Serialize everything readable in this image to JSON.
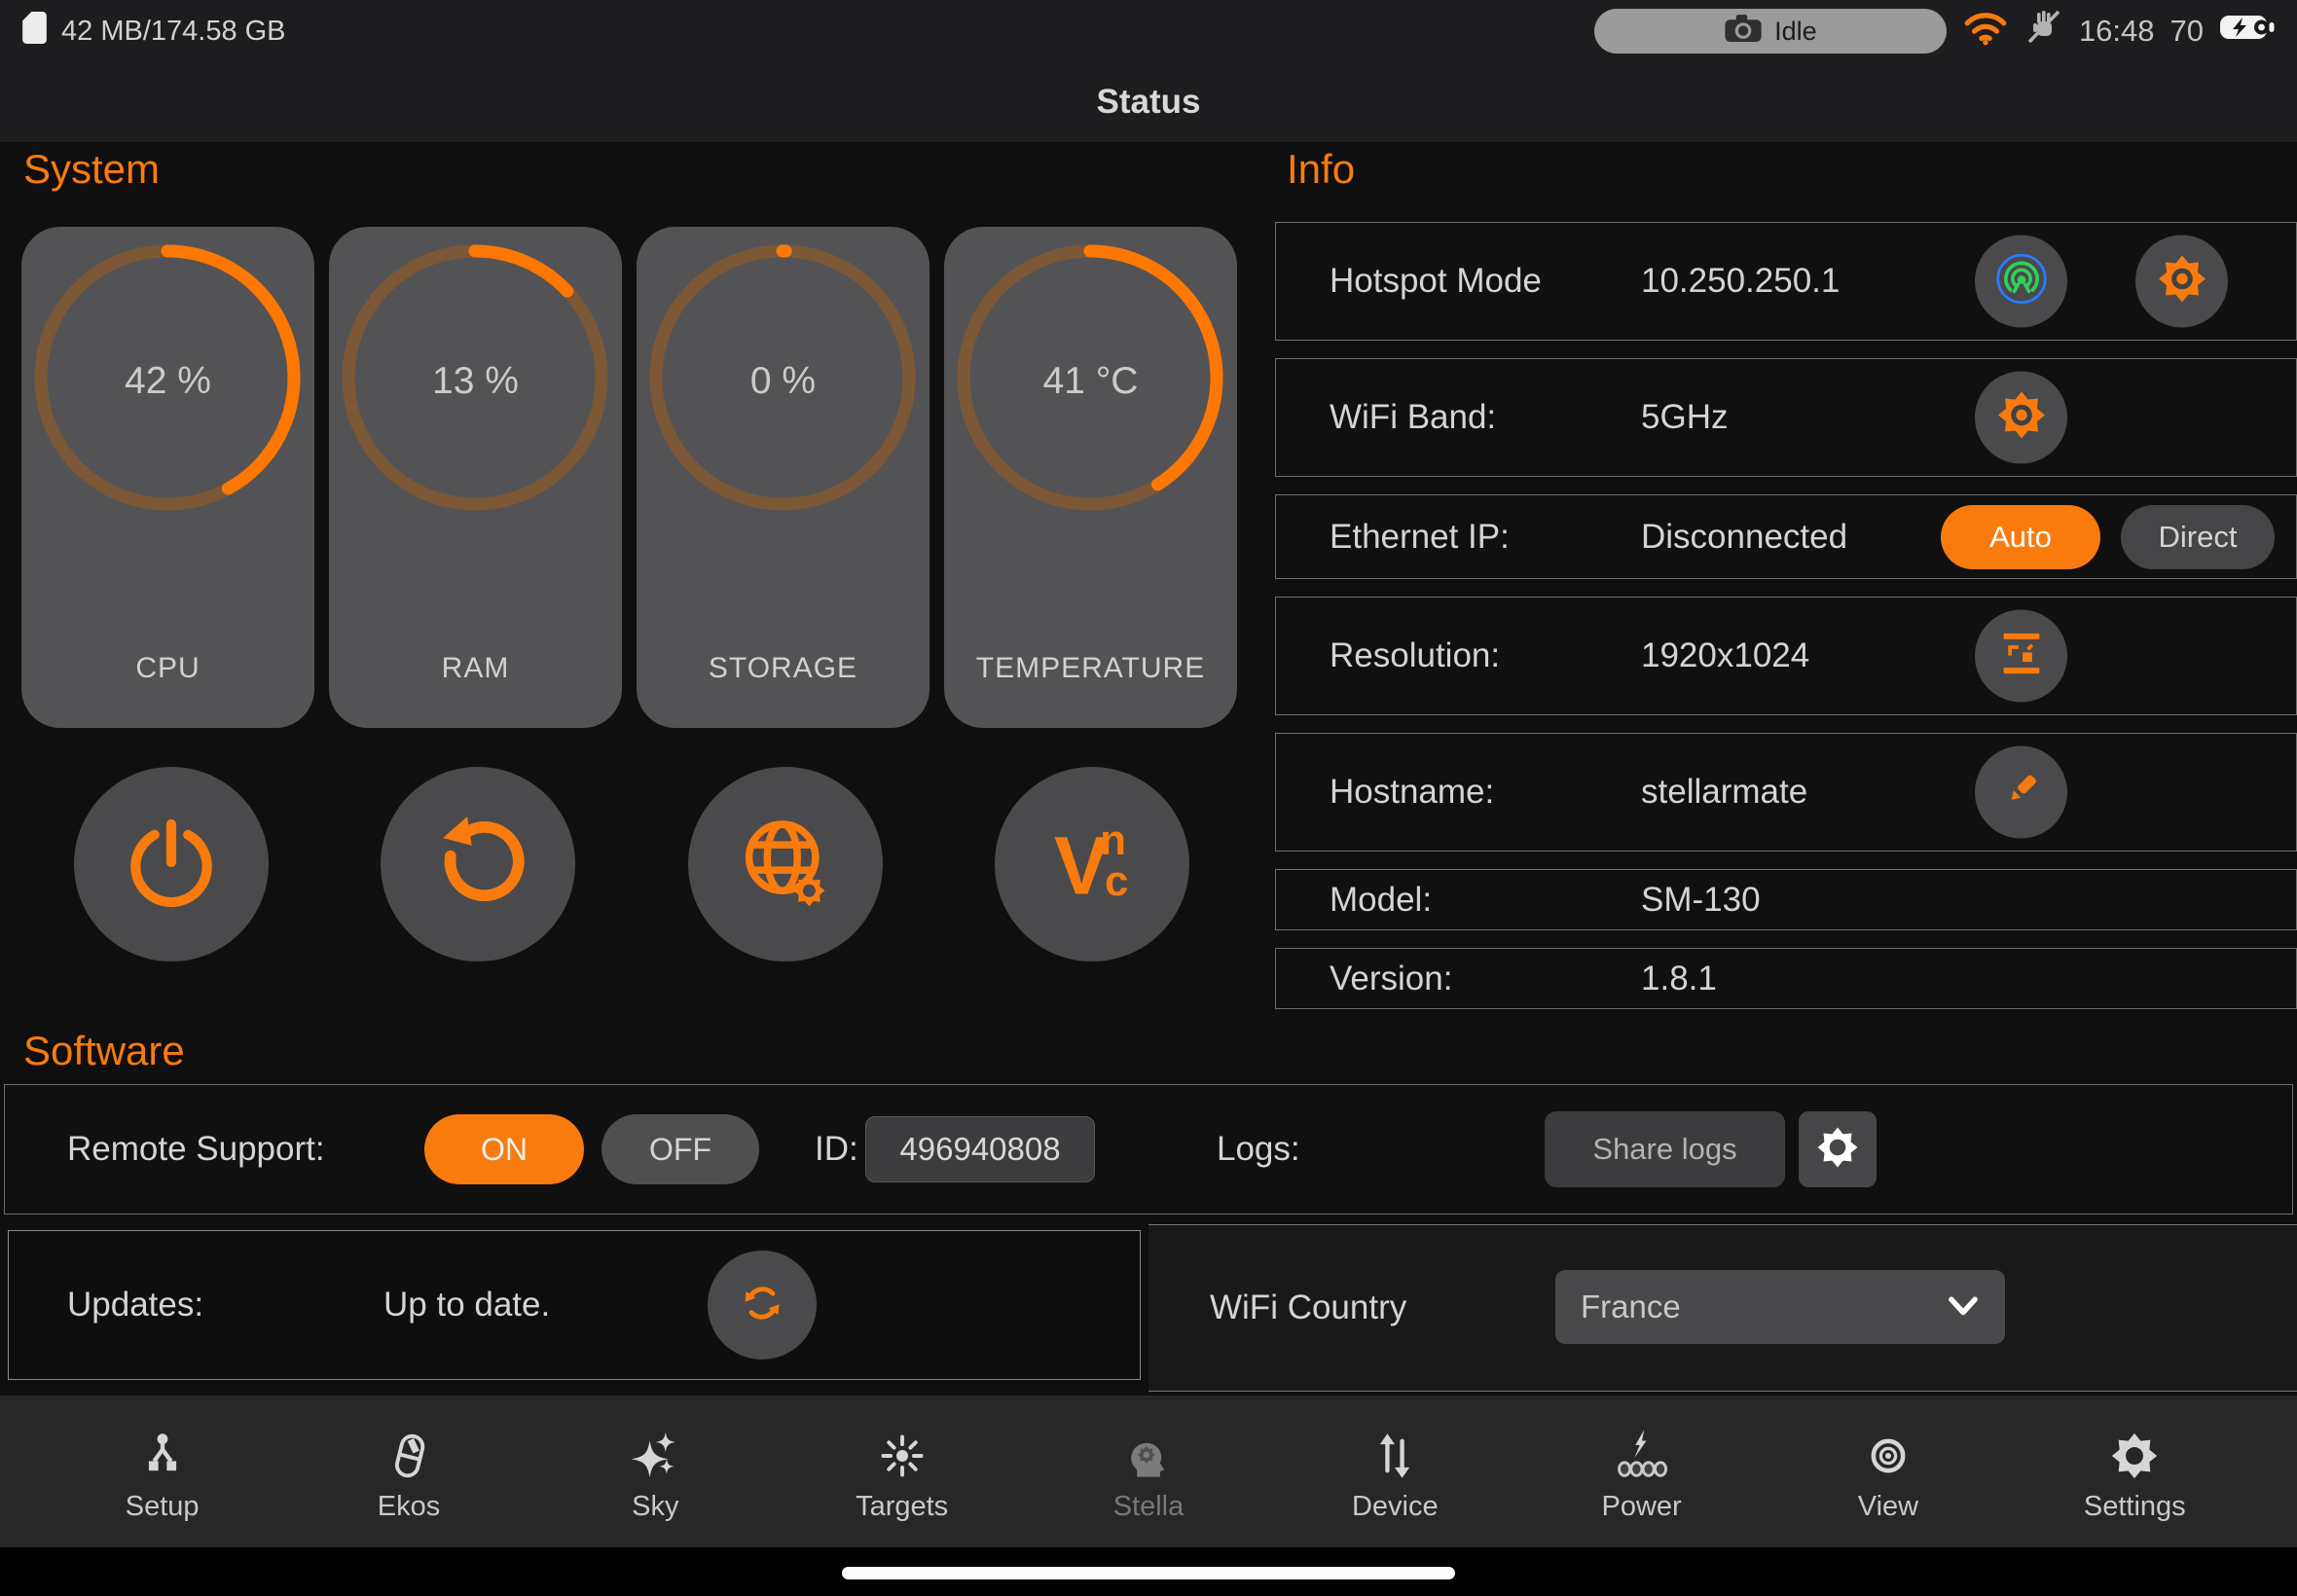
{
  "colors": {
    "accent": "#f97b0d",
    "hotspot_green": "#30d158",
    "hotspot_blue": "#2b7bff",
    "arc_orange": "#fe7701",
    "arc_track": "#7c5836"
  },
  "status_bar": {
    "storage": "42 MB/174.58 GB",
    "camera_status": "Idle",
    "time": "16:48",
    "battery_percent": "70",
    "icons": [
      "sd-card-icon",
      "camera-icon",
      "wifi-icon",
      "mute-icon",
      "battery-charging-icon"
    ]
  },
  "header": {
    "title": "Status"
  },
  "system": {
    "heading": "System",
    "gauges": [
      {
        "label": "CPU",
        "value": "42 %",
        "percent": 42
      },
      {
        "label": "RAM",
        "value": "13 %",
        "percent": 13
      },
      {
        "label": "STORAGE",
        "value": "0 %",
        "percent": 0
      },
      {
        "label": "TEMPERATURE",
        "value": "41 °C",
        "percent": 41
      }
    ],
    "actions": [
      {
        "icon": "power-icon"
      },
      {
        "icon": "restart-icon"
      },
      {
        "icon": "web-globe-icon"
      },
      {
        "icon": "vnc-icon"
      }
    ]
  },
  "info": {
    "heading": "Info",
    "rows": [
      {
        "label": "Hotspot Mode",
        "value": "10.250.250.1",
        "icons": [
          "hotspot-icon",
          "gear-icon"
        ]
      },
      {
        "label": "WiFi Band:",
        "value": "5GHz",
        "icons": [
          "gear-icon"
        ]
      },
      {
        "label": "Ethernet IP:",
        "value": "Disconnected",
        "auto": "Auto",
        "direct": "Direct"
      },
      {
        "label": "Resolution:",
        "value": "1920x1024",
        "icons": [
          "resolution-icon"
        ]
      },
      {
        "label": "Hostname:",
        "value": "stellarmate",
        "icons": [
          "pencil-icon"
        ]
      },
      {
        "label": "Model:",
        "value": "SM-130"
      },
      {
        "label": "Version:",
        "value": "1.8.1"
      }
    ]
  },
  "software": {
    "heading": "Software",
    "remote_label": "Remote Support:",
    "on_label": "ON",
    "off_label": "OFF",
    "id_label": "ID:",
    "id_value": "496940808",
    "logs_label": "Logs:",
    "share_label": "Share logs",
    "updates_label": "Updates:",
    "updates_value": "Up to date.",
    "wifi_country_label": "WiFi Country",
    "wifi_country_value": "France"
  },
  "nav": {
    "items": [
      {
        "label": "Setup",
        "icon": "setup-icon"
      },
      {
        "label": "Ekos",
        "icon": "ekos-icon"
      },
      {
        "label": "Sky",
        "icon": "sky-icon"
      },
      {
        "label": "Targets",
        "icon": "targets-icon"
      },
      {
        "label": "Stella",
        "icon": "stella-icon",
        "disabled": true
      },
      {
        "label": "Device",
        "icon": "device-icon"
      },
      {
        "label": "Power",
        "icon": "power-outlets-icon"
      },
      {
        "label": "View",
        "icon": "view-eye-icon"
      },
      {
        "label": "Settings",
        "icon": "settings-gear-icon"
      }
    ]
  }
}
